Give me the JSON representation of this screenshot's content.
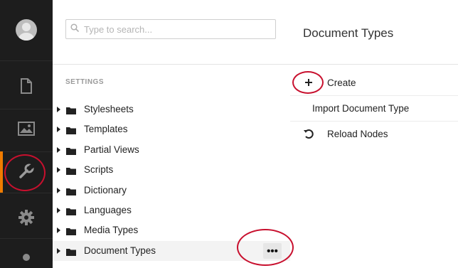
{
  "search": {
    "placeholder": "Type to search..."
  },
  "tree": {
    "section_label": "SETTINGS",
    "items": [
      {
        "label": "Stylesheets"
      },
      {
        "label": "Templates"
      },
      {
        "label": "Partial Views"
      },
      {
        "label": "Scripts"
      },
      {
        "label": "Dictionary"
      },
      {
        "label": "Languages"
      },
      {
        "label": "Media Types"
      },
      {
        "label": "Document Types"
      }
    ],
    "more_button": "•••"
  },
  "actions_panel": {
    "title": "Document Types",
    "actions": [
      {
        "label": "Create",
        "icon": "plus-icon"
      },
      {
        "label": "Import Document Type",
        "icon": ""
      },
      {
        "label": "Reload Nodes",
        "icon": "reload-icon"
      }
    ]
  },
  "rail": {
    "icons": [
      "avatar",
      "content-icon",
      "media-icon",
      "settings-wrench-icon",
      "gear-icon",
      "user-icon"
    ],
    "active": "settings-wrench-icon"
  },
  "colors": {
    "rail_bg": "#1d1d1d",
    "active_accent": "#f07c00",
    "annotation": "#c8102e"
  }
}
